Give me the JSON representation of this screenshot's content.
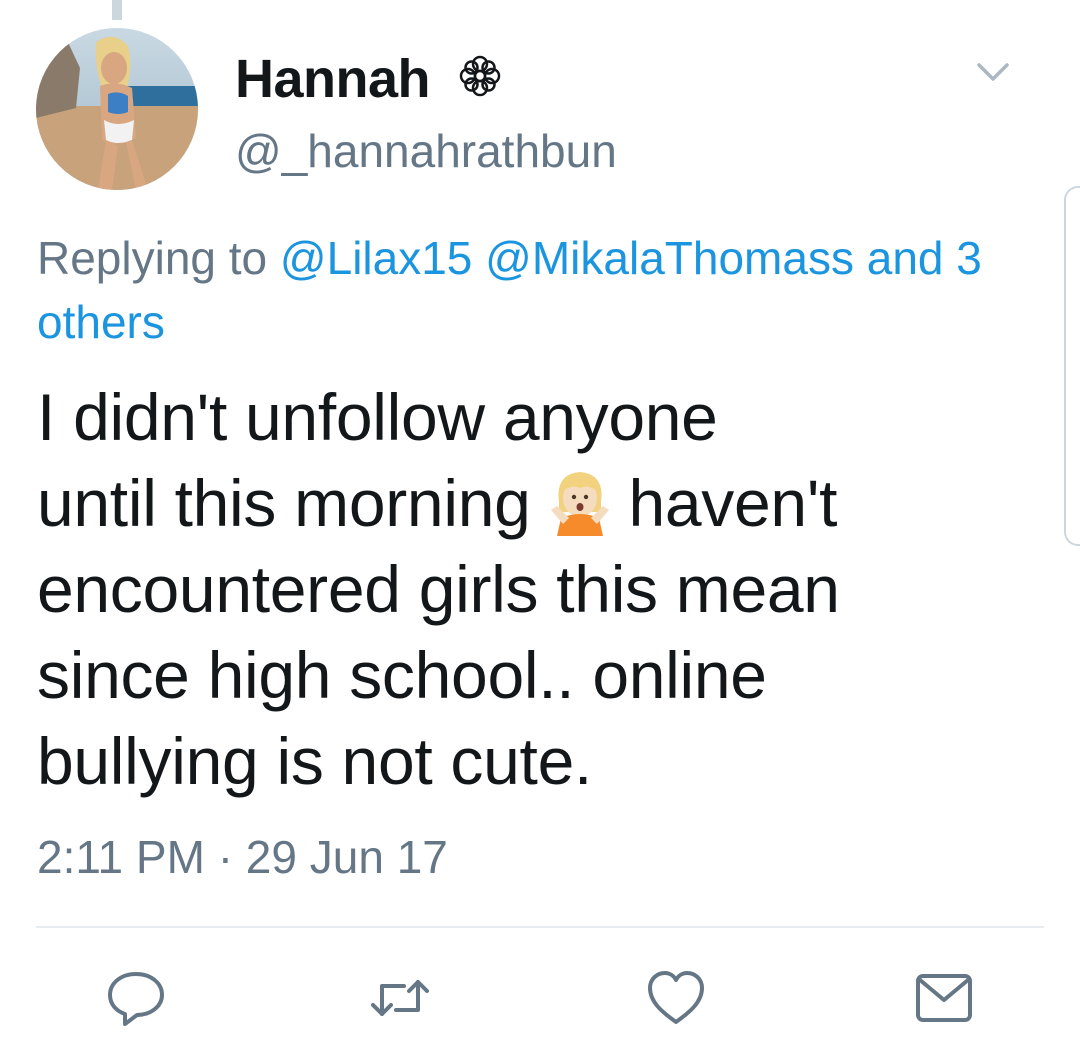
{
  "user": {
    "display_name": "Hannah",
    "handle": "@_hannahrathbun",
    "name_decoration_icon": "flower-icon"
  },
  "reply": {
    "prefix": "Replying to",
    "mentions": [
      "@Lilax15",
      "@MikalaThomass",
      "and",
      "3 others"
    ]
  },
  "tweet": {
    "line1": "I didn't unfollow anyone",
    "line2a": "until this morning",
    "emoji_icon": "person-gesturing-no-emoji",
    "line2b": "haven't",
    "line3": "encountered girls this mean",
    "line4": "since high school.. online",
    "line5": "bullying is not cute."
  },
  "meta": {
    "time": "2:11 PM",
    "separator": "·",
    "date": "29 Jun 17"
  },
  "actions": [
    {
      "name": "reply-icon"
    },
    {
      "name": "retweet-icon"
    },
    {
      "name": "like-icon"
    },
    {
      "name": "share-icon"
    }
  ],
  "colors": {
    "link": "#1b95e0",
    "secondary_text": "#657786",
    "primary_text": "#14171a",
    "divider": "#e6ecf0"
  }
}
